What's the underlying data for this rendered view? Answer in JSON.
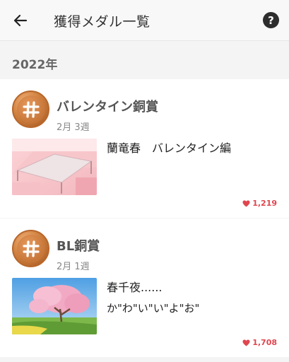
{
  "header": {
    "title": "獲得メダル一覧",
    "back_icon": "arrow-left-icon",
    "help_icon": "help-icon",
    "help_glyph": "?"
  },
  "year": "2022年",
  "medals": [
    {
      "award": "バレンタイン銅賞",
      "week": "2月 3週",
      "work_title": "蘭竜春　バレンタイン編",
      "work_subtitle": "",
      "likes": "1,219"
    },
    {
      "award": "BL銅賞",
      "week": "2月 1週",
      "work_title": "春千夜......",
      "work_subtitle": "か\"わ\"い\"い\"よ\"お\"",
      "likes": "1,708"
    }
  ],
  "colors": {
    "bronze": "#c87a3a",
    "heart": "#e0464f"
  }
}
